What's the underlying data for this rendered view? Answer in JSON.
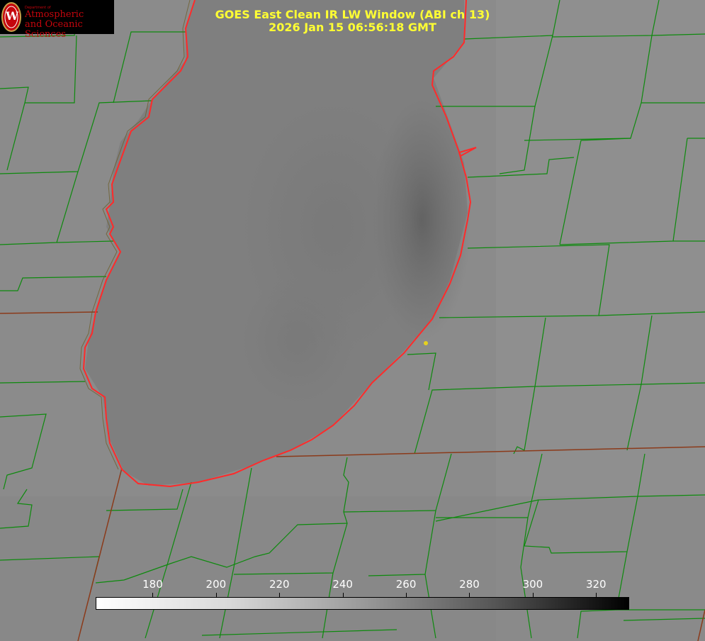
{
  "logo": {
    "department": "Department of",
    "line1": "Atmospheric",
    "line2": "and Oceanic Sciences",
    "seal_letter": "W",
    "color": "#c5050c"
  },
  "title": {
    "line1": "GOES East Clean IR LW Window (ABI ch 13)",
    "line2": "2026 Jan 15 06:56:18 GMT",
    "color": "#ffff33"
  },
  "colorbar": {
    "ticks": [
      "180",
      "200",
      "220",
      "240",
      "260",
      "280",
      "300",
      "320"
    ],
    "min": 162,
    "max": 330,
    "gradient": "white-to-black"
  },
  "colors": {
    "background_gray": "#8c8c8c",
    "county_lines": "#0d8a0d",
    "lake_outline": "#ff2a2a",
    "state_border": "#8b3a1a",
    "marker": "#e6d21e"
  }
}
